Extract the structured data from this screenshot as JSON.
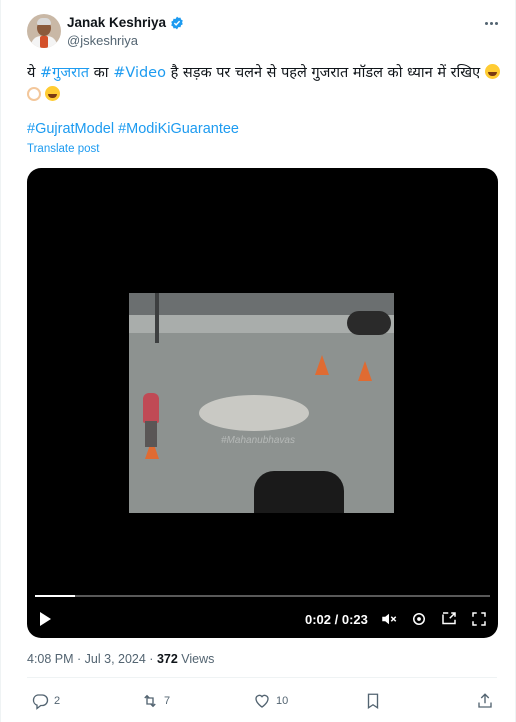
{
  "post": {
    "author_name": "Janak Keshriya",
    "handle": "@jskeshriya",
    "text": {
      "part1": "ये ",
      "tag1": "#गुजरात",
      "part2": " का ",
      "tag2": "#Video",
      "part3": " है सड़क पर चलने से पहले गुजरात मॉडल को ध्यान में रखिए "
    },
    "hashtags": "#GujratModel #ModiKiGuarantee",
    "translate_label": "Translate post",
    "timestamp": "4:08 PM · Jul 3, 2024 · ",
    "views_count": "372",
    "views_label": " Views"
  },
  "video": {
    "watermark": "#Mahanubhavas",
    "time_display": "0:02 / 0:23",
    "progress": 0.087
  },
  "actions": {
    "replies": "2",
    "reposts": "7",
    "likes": "10"
  },
  "colors": {
    "accent": "#1d9bf0",
    "text": "#0f1419",
    "muted": "#536471"
  }
}
